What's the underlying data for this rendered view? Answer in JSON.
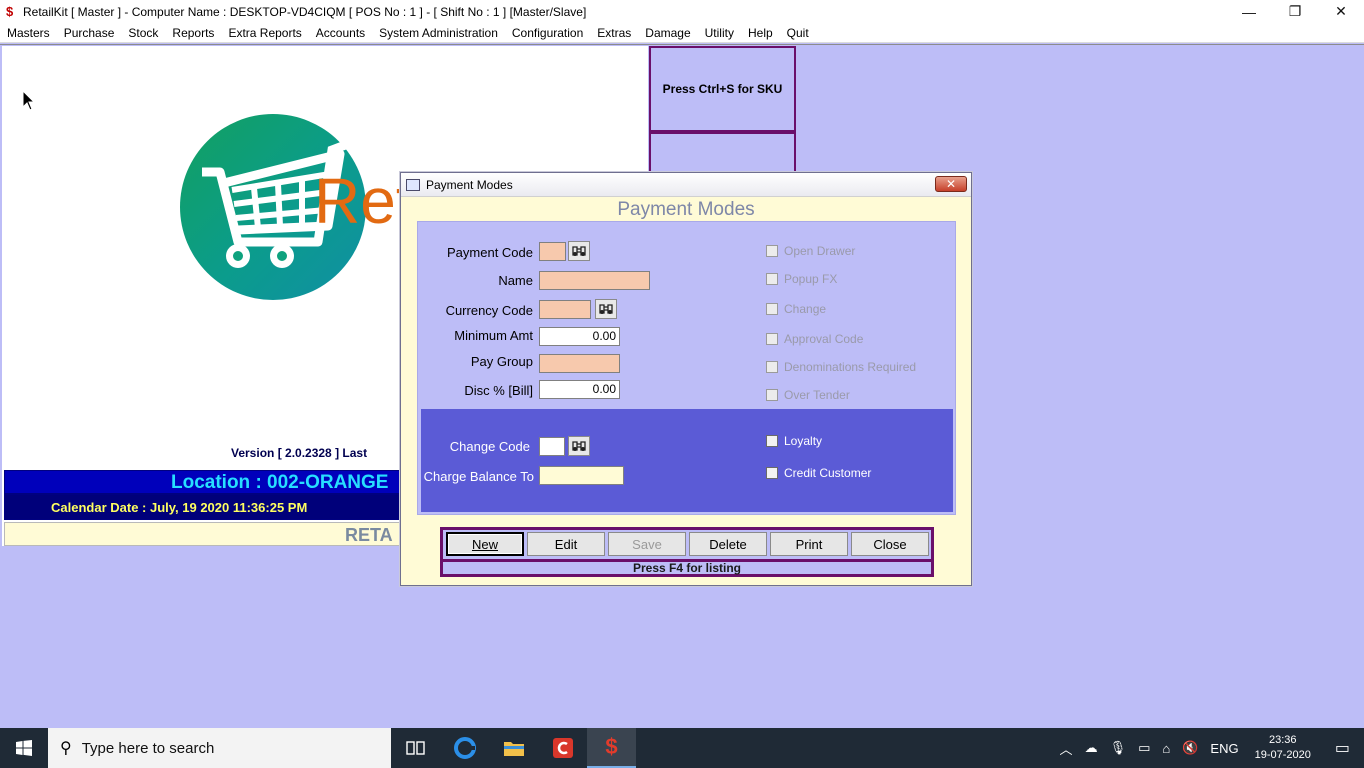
{
  "window": {
    "title": "RetailKit [ Master ] - Computer Name : DESKTOP-VD4CIQM [ POS No : 1 ] - [ Shift No : 1 ]  [Master/Slave]",
    "minimize": "—",
    "restore": "❐",
    "close": "✕"
  },
  "menu": [
    "Masters",
    "Purchase",
    "Stock",
    "Reports",
    "Extra Reports",
    "Accounts",
    "System Administration",
    "Configuration",
    "Extras",
    "Damage",
    "Utility",
    "Help",
    "Quit"
  ],
  "background_panel": {
    "logo_text": "Ret",
    "version": "Version [ 2.0.2328 ]  Last",
    "location": "Location : 002-ORANGE",
    "calendar": "Calendar Date : July, 19 2020 11:36:25 PM",
    "retail_banner": "RETA"
  },
  "sku_panel": {
    "text": "Press Ctrl+S for SKU"
  },
  "dialog": {
    "title": "Payment Modes",
    "heading": "Payment Modes",
    "close_label": "✕",
    "fields": {
      "payment_code": {
        "label": "Payment Code",
        "value": ""
      },
      "name": {
        "label": "Name",
        "value": ""
      },
      "currency_code": {
        "label": "Currency Code",
        "value": ""
      },
      "minimum_amt": {
        "label": "Minimum Amt",
        "value": "0.00"
      },
      "pay_group": {
        "label": "Pay Group",
        "value": ""
      },
      "disc_bill": {
        "label": "Disc % [Bill]",
        "value": "0.00"
      },
      "change_code": {
        "label": "Change Code",
        "value": ""
      },
      "charge_balance_to": {
        "label": "Charge Balance To",
        "value": ""
      }
    },
    "checkboxes": {
      "open_drawer": "Open Drawer",
      "popup_fx": "Popup FX",
      "change": "Change",
      "approval_code": "Approval Code",
      "denominations_required": "Denominations Required",
      "over_tender": "Over Tender",
      "loyalty": "Loyalty",
      "credit_customer": "Credit Customer"
    },
    "buttons": {
      "new": "New",
      "edit": "Edit",
      "save": "Save",
      "delete": "Delete",
      "print": "Print",
      "close": "Close"
    },
    "hint": "Press F4 for listing"
  },
  "taskbar": {
    "search_placeholder": "Type here to search",
    "language": "ENG",
    "time": "23:36",
    "date": "19-07-2020"
  },
  "colors": {
    "workspace": "#bdbdf7",
    "accent_purple": "#6a0f6a",
    "location_blue": "#0000bb",
    "location_text": "#27dfff",
    "calendar_text": "#ffff60",
    "field_peach": "#f7c9ad",
    "dialog_bg": "#fffbd6"
  }
}
